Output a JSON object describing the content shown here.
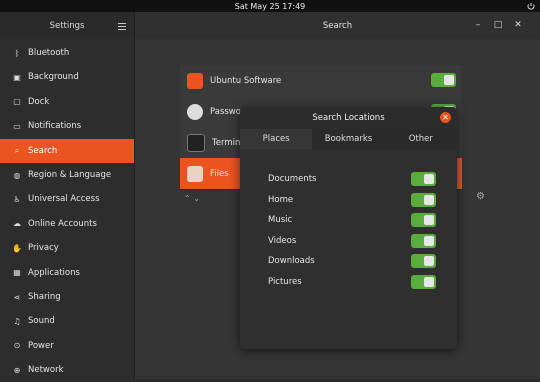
{
  "topbar": {
    "clock": "Sat May 25  17:49"
  },
  "sidebar": {
    "title": "Settings",
    "items": [
      {
        "label": "Bluetooth",
        "icon": "bluetooth-icon",
        "glyph": "ᛒ"
      },
      {
        "label": "Background",
        "icon": "background-icon",
        "glyph": "▣"
      },
      {
        "label": "Dock",
        "icon": "dock-icon",
        "glyph": "▢"
      },
      {
        "label": "Notifications",
        "icon": "notifications-icon",
        "glyph": "▭"
      },
      {
        "label": "Search",
        "icon": "search-icon",
        "glyph": "⌕",
        "active": true
      },
      {
        "label": "Region & Language",
        "icon": "globe-icon",
        "glyph": "◍"
      },
      {
        "label": "Universal Access",
        "icon": "accessibility-icon",
        "glyph": "♿"
      },
      {
        "label": "Online Accounts",
        "icon": "cloud-icon",
        "glyph": "☁"
      },
      {
        "label": "Privacy",
        "icon": "hand-icon",
        "glyph": "✋"
      },
      {
        "label": "Applications",
        "icon": "applications-icon",
        "glyph": "▦"
      },
      {
        "label": "Sharing",
        "icon": "share-icon",
        "glyph": "⋖"
      },
      {
        "label": "Sound",
        "icon": "music-note-icon",
        "glyph": "♫"
      },
      {
        "label": "Power",
        "icon": "power-icon",
        "glyph": "⊙"
      },
      {
        "label": "Network",
        "icon": "network-icon",
        "glyph": "⊕"
      }
    ]
  },
  "header": {
    "title": "Search",
    "enabled": true,
    "accent": "#e95420"
  },
  "apps": [
    {
      "label": "Ubuntu Software",
      "icon": "ubuntu-software-icon",
      "enabled": true
    },
    {
      "label": "Passwords and Keys",
      "icon": "passwords-keys-icon",
      "enabled": true
    },
    {
      "label": "Terminal",
      "icon": "terminal-icon",
      "enabled": true
    },
    {
      "label": "Files",
      "icon": "files-icon",
      "enabled": true
    }
  ],
  "dialog": {
    "title": "Search Locations",
    "tabs": [
      "Places",
      "Bookmarks",
      "Other"
    ],
    "active_tab": "Places",
    "locations": [
      {
        "label": "Documents",
        "enabled": true
      },
      {
        "label": "Home",
        "enabled": true
      },
      {
        "label": "Music",
        "enabled": true
      },
      {
        "label": "Videos",
        "enabled": true
      },
      {
        "label": "Downloads",
        "enabled": true
      },
      {
        "label": "Pictures",
        "enabled": true
      }
    ]
  },
  "colors": {
    "switch_on": "#5aac3d",
    "accent": "#e95420"
  }
}
